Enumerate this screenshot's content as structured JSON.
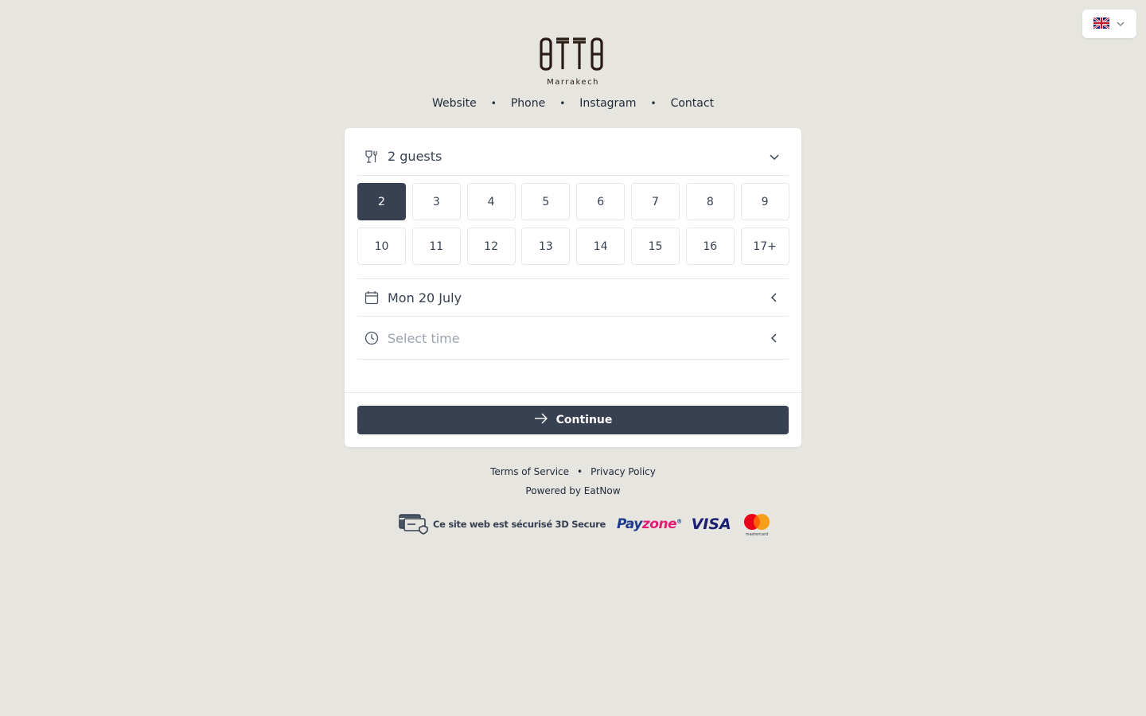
{
  "language": {
    "flag": "uk-flag-icon",
    "chevron": "chevron-down-icon"
  },
  "brand": {
    "logo_text": "OTTO",
    "location": "Marrakech"
  },
  "nav": {
    "website": "Website",
    "phone": "Phone",
    "instagram": "Instagram",
    "contact": "Contact",
    "separator": "•"
  },
  "booking": {
    "guests_label": "2 guests",
    "guest_options": [
      "2",
      "3",
      "4",
      "5",
      "6",
      "7",
      "8",
      "9",
      "10",
      "11",
      "12",
      "13",
      "14",
      "15",
      "16",
      "17+"
    ],
    "selected_guests": "2",
    "date_label": "Mon 20 July",
    "time_placeholder": "Select time",
    "continue_label": "Continue"
  },
  "footer": {
    "terms": "Terms of Service",
    "privacy": "Privacy Policy",
    "separator": "•",
    "powered": "Powered by EatNow",
    "secure_text": "Ce site web est sécurisé 3D Secure",
    "payzone_a": "Pay",
    "payzone_b": "zone",
    "payzone_mark": "®",
    "visa": "VISA",
    "mastercard": "mastercard"
  },
  "colors": {
    "background": "#e6e5df",
    "primary": "#374151",
    "card": "#ffffff"
  }
}
